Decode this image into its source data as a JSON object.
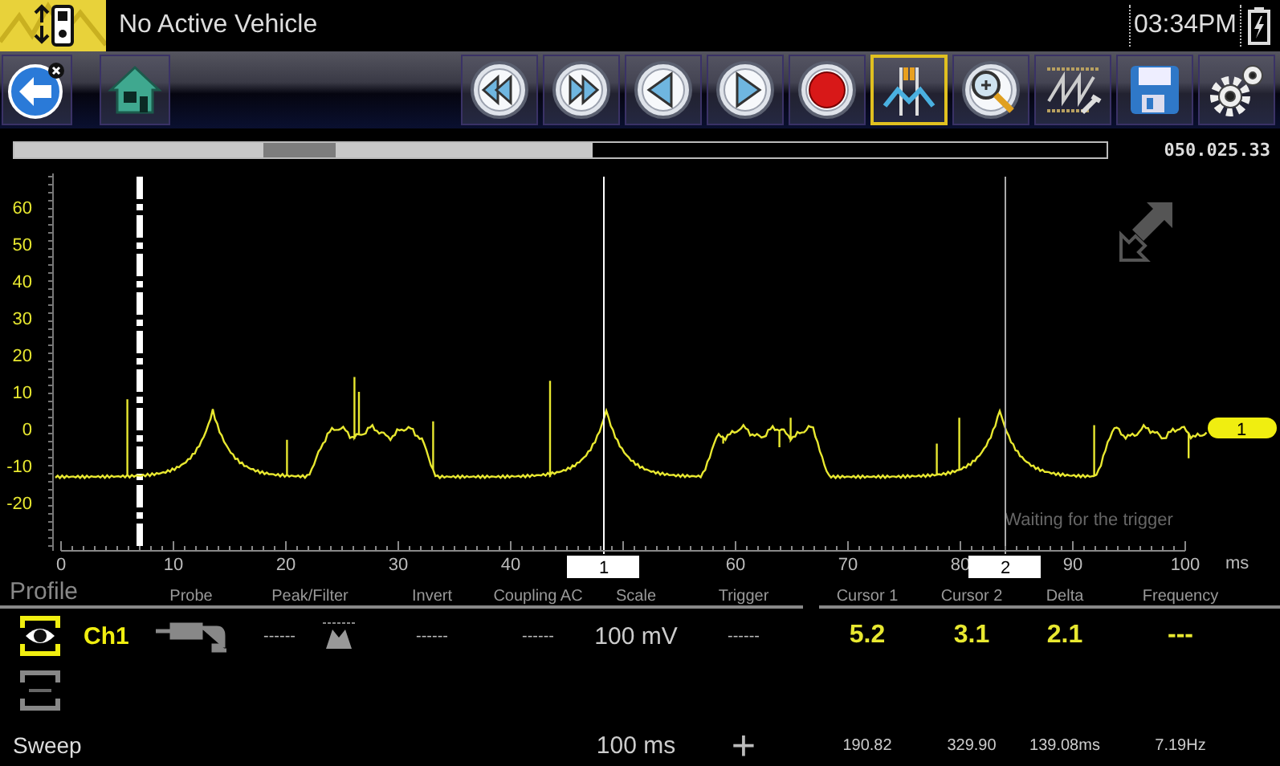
{
  "header": {
    "title": "No Active Vehicle",
    "time": "03:34PM"
  },
  "toolbar": {
    "nav": [
      {
        "kind": "back"
      },
      {
        "kind": "home"
      }
    ],
    "tools": [
      {
        "kind": "rewind",
        "selected": false
      },
      {
        "kind": "fast-forward",
        "selected": false
      },
      {
        "kind": "step-back",
        "selected": false
      },
      {
        "kind": "step-forward",
        "selected": false
      },
      {
        "kind": "record",
        "selected": false
      },
      {
        "kind": "cursors",
        "selected": true
      },
      {
        "kind": "zoom",
        "selected": false
      },
      {
        "kind": "trace-settings",
        "selected": false
      },
      {
        "kind": "save",
        "selected": false
      },
      {
        "kind": "settings",
        "selected": false
      }
    ]
  },
  "overview": {
    "level": 0.53,
    "reading": "050.025.33"
  },
  "plot": {
    "y_labels": [
      "60",
      "50",
      "40",
      "30",
      "20",
      "10",
      "0",
      "-10",
      "-20"
    ],
    "x_labels": [
      "0",
      "10",
      "20",
      "30",
      "40",
      "60",
      "70",
      "80",
      "90",
      "100"
    ],
    "x_unit": "ms",
    "cursors": [
      {
        "label": "1"
      },
      {
        "label": "2"
      }
    ],
    "trace_marker": "1",
    "status": "Waiting for the trigger"
  },
  "table": {
    "columns": [
      "Profile",
      "Probe",
      "Peak/Filter",
      "Invert",
      "Coupling AC",
      "Scale",
      "Trigger",
      "Cursor 1",
      "Cursor 2",
      "Delta",
      "Frequency"
    ],
    "channels": [
      {
        "label": "Ch1",
        "selected": true,
        "visible": true,
        "peak": "------",
        "invert": "------",
        "coupling": "------",
        "scale": "100 mV",
        "trigger": "------",
        "cursor_1": "5.2",
        "cursor_2": "3.1",
        "delta": "2.1",
        "frequency": "---"
      },
      {
        "selected": false,
        "visible": false
      }
    ],
    "sweep": {
      "label": "Sweep",
      "scale": "100 ms",
      "add": "+",
      "cursor_1": "190.82",
      "cursor_2": "329.90",
      "delta": "139.08ms",
      "frequency": "7.19Hz"
    }
  }
}
